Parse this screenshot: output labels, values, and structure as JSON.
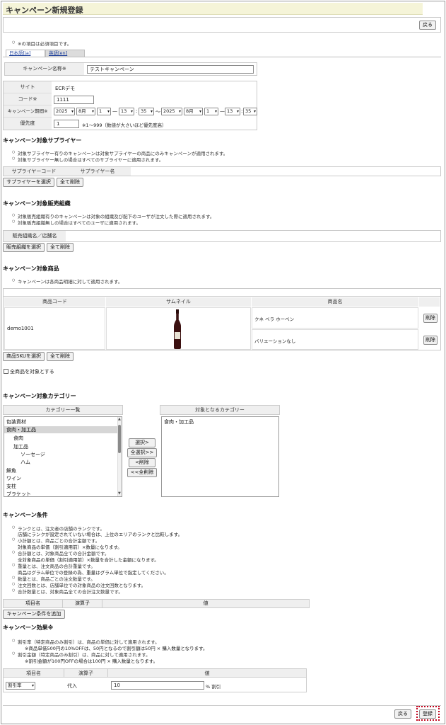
{
  "page_title": "キャンペーン新規登録",
  "back_label": "戻る",
  "register_label": "登録",
  "required_note": "※の項目は必須項目です。",
  "tabs": [
    "日本語[ja]",
    "英語[en]"
  ],
  "name_field": {
    "label": "キャンペーン名称※",
    "value": "テストキャンペーン"
  },
  "form": {
    "site_label": "サイト",
    "site_value": "ECRデモ",
    "code_label": "コード※",
    "code_value": "1111",
    "period_label": "キャンペーン期間※",
    "period_start": {
      "year": "2025",
      "month": "8月",
      "day": "1",
      "hour": "13",
      "min": "35"
    },
    "period_end": {
      "year": "2025",
      "month": "8月",
      "day": "1",
      "hour": "13",
      "min": "35"
    },
    "dash": "—",
    "colon": ":",
    "tilde": "〜",
    "priority_label": "優先度",
    "priority_value": "1",
    "priority_hint": "※1〜999（数値が大さいほど優先度高）"
  },
  "supplier": {
    "heading": "キャンペーン対象サプライヤー",
    "notes": [
      "対象サプライヤー有りのキャンペーンは対象サプライヤーの商品にのみキャンペーンが適用されます。",
      "対象サプライヤー無しの場合はすべてのサプライヤーに適用されます。"
    ],
    "col_code": "サプライヤーコード",
    "col_name": "サプライヤー名",
    "select_label": "サプライヤーを選択",
    "delete_all_label": "全て削除"
  },
  "org": {
    "heading": "キャンペーン対象販売組織",
    "notes": [
      "対象販売組織有りのキャンペーンは対象の組織及び配下のユーザが注文した際に適用されます。",
      "対象販売組織無しの場合はすべてのユーザに適用されます。"
    ],
    "col_name": "販売組織名／店舗名",
    "select_label": "販売組織を選択",
    "delete_all_label": "全て削除"
  },
  "product": {
    "heading": "キャンペーン対象商品",
    "notes": [
      "キャンペーンは各商品明細に対して適用されます。"
    ],
    "col_code": "商品コード",
    "col_thumb": "サムネイル",
    "col_name": "商品名",
    "row_code": "demo1001",
    "variant1": "クネ ベラ ホーベン",
    "variant2": "バリエーションなし",
    "delete_label": "削除",
    "select_label": "商品SKUを選択",
    "delete_all_label": "全て削除",
    "all_products_label": "全商品を対象とする"
  },
  "category": {
    "heading": "キャンペーン対象カテゴリー",
    "list_header": "カテゴリー一覧",
    "target_header": "対象となるカテゴリー",
    "items": [
      "包装資材",
      "食肉・加工品",
      "食肉",
      "加工品",
      "ソーセージ",
      "ハム",
      "鮮魚",
      "ワイン",
      "支柱",
      "ブラケット"
    ],
    "targets": [
      "食肉・加工品"
    ],
    "select_btn": "選択>",
    "select_all_btn": "全選択>>",
    "remove_btn": "<削除",
    "remove_all_btn": "<<全削除"
  },
  "conditions": {
    "heading": "キャンペーン条件",
    "notes": [
      "ランクとは、注文者の店舗のランクです。",
      "店舗にランクが設定されていない場合は、上位のエリアのランクと比較します。",
      "小計額とは、商品ごとの合計金額です。",
      "対象商品の単価（割引適用前）×数量になります。",
      "合計額とは、対象商品全ての合計金額です。",
      "全対象商品の単価（割引適用前）×数量を合計した金額になります。",
      "重量とは、注文商品の合計重量です。",
      "商品はグラム単位での登録の為、重量はグラム単位で指定してください。",
      "数量とは、商品ごとの注文数量です。",
      "注文回数とは、店舗単位での対象商品の注文回数となります。",
      "合計数量とは、対象商品全ての合計注文数量です。"
    ],
    "col_item": "項目名",
    "col_op": "演算子",
    "col_value": "値",
    "add_label": "キャンペーン条件を追加"
  },
  "effect": {
    "heading": "キャンペーン効果※",
    "notes": [
      "割引率（特定商品のみ割引）は、商品の単価に対して適用されます。",
      "※商品単価500円の10%OFFは、50円となるので割引額は50円 × 購入数量となります。",
      "割引金額（特定商品のみ割引）は、商品に対して適用されます。",
      "※割引金額が100円OFFの場合は100円 × 購入数量となります。"
    ],
    "col_item": "項目名",
    "col_op": "演算子",
    "col_value": "値",
    "item_value": "割引率",
    "op_value": "代入",
    "value": "10",
    "unit": "% 割引"
  },
  "icons": {
    "dropdown": "chevron-down-icon"
  }
}
